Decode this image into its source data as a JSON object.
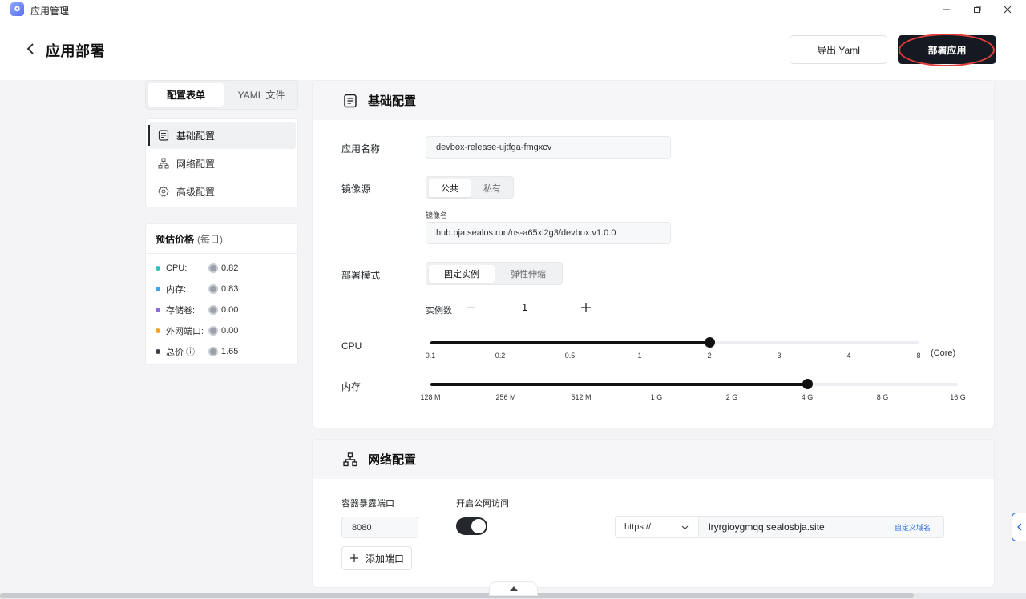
{
  "window": {
    "title": "应用管理"
  },
  "header": {
    "page_title": "应用部署",
    "export_label": "导出 Yaml",
    "deploy_label": "部署应用"
  },
  "tabs": [
    {
      "label": "配置表单",
      "active": true
    },
    {
      "label": "YAML 文件",
      "active": false
    }
  ],
  "sidebar_nav": [
    {
      "label": "基础配置",
      "icon": "document-icon",
      "active": true
    },
    {
      "label": "网络配置",
      "icon": "network-icon",
      "active": false
    },
    {
      "label": "高级配置",
      "icon": "gear-icon",
      "active": false
    }
  ],
  "price": {
    "title": "预估价格",
    "period": "(每日)",
    "items": [
      {
        "label": "CPU:",
        "value": "0.82",
        "color": "#2fc2b8"
      },
      {
        "label": "内存:",
        "value": "0.83",
        "color": "#3aa8e8"
      },
      {
        "label": "存储卷:",
        "value": "0.00",
        "color": "#8a6ed8"
      },
      {
        "label": "外网端口:",
        "value": "0.00",
        "color": "#f5a623"
      },
      {
        "label": "总价 ⓘ:",
        "value": "1.65",
        "color": "#3b3f46"
      }
    ]
  },
  "basic": {
    "title": "基础配置",
    "app_name_label": "应用名称",
    "app_name_value": "devbox-release-ujtfga-fmgxcv",
    "image_source_label": "镜像源",
    "image_source_options": [
      "公共",
      "私有"
    ],
    "image_source_selected": "公共",
    "image_name_label": "镜像名",
    "image_name_value": "hub.bja.sealos.run/ns-a65xl2g3/devbox:v1.0.0",
    "deploy_mode_label": "部署模式",
    "deploy_mode_options": [
      "固定实例",
      "弹性伸缩"
    ],
    "deploy_mode_selected": "固定实例",
    "instances_label": "实例数",
    "instances_value": "1",
    "cpu_label": "CPU",
    "cpu_ticks": [
      "0.1",
      "0.2",
      "0.5",
      "1",
      "2",
      "3",
      "4",
      "8"
    ],
    "cpu_selected": "2",
    "cpu_unit": "(Core)",
    "memory_label": "内存",
    "memory_ticks": [
      "128 M",
      "256 M",
      "512 M",
      "1 G",
      "2 G",
      "4 G",
      "8 G",
      "16 G"
    ],
    "memory_selected": "4 G"
  },
  "network": {
    "title": "网络配置",
    "port_label": "容器暴露端口",
    "port_value": "8080",
    "public_access_label": "开启公网访问",
    "public_access_on": true,
    "protocol": "https://",
    "domain": "lryrgioygmqq.sealosbja.site",
    "custom_domain_label": "自定义域名",
    "add_port_label": "添加端口"
  }
}
